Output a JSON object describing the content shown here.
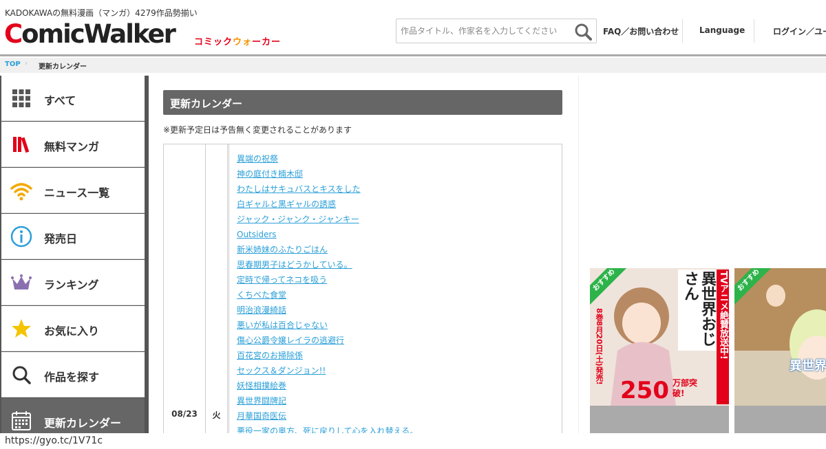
{
  "header": {
    "tagline": "KADOKAWAの無料漫画（マンガ）4279作品勢揃い",
    "logo_text": "ComicWalker",
    "logo_sub": "コミックウォーカー",
    "search_placeholder": "作品タイトル、作家名を入力してください",
    "faq": "FAQ／お問い合わせ",
    "language": "Language",
    "login": "ログイン／ユー"
  },
  "breadcrumb": {
    "top": "TOP",
    "sep": "›",
    "current": "更新カレンダー"
  },
  "sidebar": {
    "items": [
      {
        "label": "すべて",
        "icon": "grid-icon"
      },
      {
        "label": "無料マンガ",
        "icon": "books-icon"
      },
      {
        "label": "ニュース一覧",
        "icon": "wifi-icon"
      },
      {
        "label": "発売日",
        "icon": "info-icon"
      },
      {
        "label": "ランキング",
        "icon": "crown-icon"
      },
      {
        "label": "お気に入り",
        "icon": "star-icon"
      },
      {
        "label": "作品を探す",
        "icon": "search-icon"
      },
      {
        "label": "更新カレンダー",
        "icon": "calendar-icon"
      }
    ]
  },
  "main": {
    "title": "更新カレンダー",
    "note": "※更新予定日は予告無く変更されることがあります",
    "calendar": {
      "date": "08/23",
      "day": "火",
      "titles": [
        "異端の祝祭",
        "神の庭付き楠木邸",
        "わたしはサキュバスとキスをした",
        "白ギャルと黒ギャルの誘惑",
        "ジャック・ジャンク・ジャンキー",
        "Outsiders",
        "新米姉妹のふたりごはん",
        "思春期男子はどうかしている。",
        "定時で帰ってネコを吸う",
        "くちべた食堂",
        "明治浪漫綺話",
        "悪いが私は百合じゃない",
        "傷心公爵令嬢レイラの逃避行",
        "百花宮のお掃除係",
        "セックス＆ダンジョン!!",
        "妖怪相撲絵巻",
        "異世界闘牌記",
        "月華国奇医伝",
        "悪役一家の奥方、死に戻りして心を入れ替える。"
      ]
    }
  },
  "right": {
    "ribbon1": "おすすめ",
    "ribbon2": "おすすめ",
    "banner1_text": "異世界おじさん",
    "banner1_tv": "TVアニメ絶賛放送中!",
    "banner1_sales": "250",
    "banner1_unit": "万部突破!",
    "banner1_release": "8巻8月20日(土)発売!",
    "banner2_text": "異世界"
  },
  "status": {
    "url": "https://gyo.tc/1V71c"
  }
}
